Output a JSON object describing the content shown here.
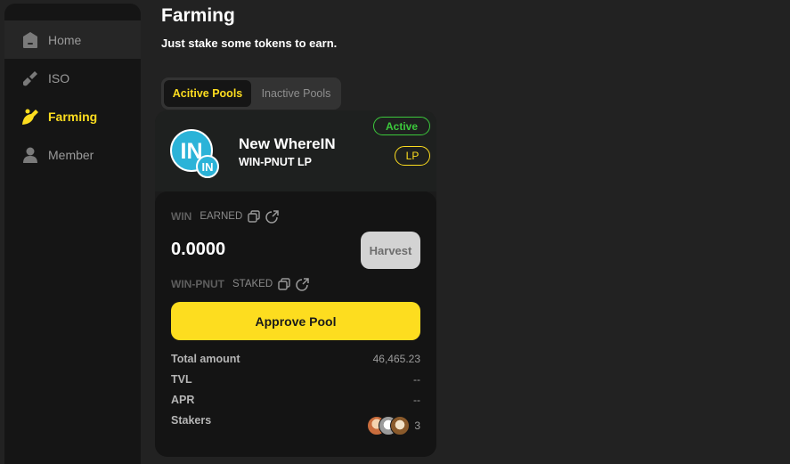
{
  "sidebar": {
    "items": [
      {
        "label": "Home",
        "icon": "home-icon"
      },
      {
        "label": "ISO",
        "icon": "shovel-icon"
      },
      {
        "label": "Farming",
        "icon": "farming-icon"
      },
      {
        "label": "Member",
        "icon": "user-icon"
      }
    ],
    "active_item": "Farming"
  },
  "header": {
    "title": "Farming",
    "subtitle": "Just stake some tokens to earn."
  },
  "tabs": [
    {
      "label": "Acitive Pools",
      "active": true
    },
    {
      "label": "Inactive Pools",
      "active": false
    }
  ],
  "pool": {
    "name": "New WhereIN",
    "pair": "WIN-PNUT LP",
    "status_badge": "Active",
    "type_badge": "LP",
    "logo_text": "IN",
    "earned": {
      "token": "WIN",
      "label": "EARNED",
      "value": "0.0000"
    },
    "harvest_label": "Harvest",
    "staked": {
      "token": "WIN-PNUT",
      "label": "STAKED"
    },
    "approve_label": "Approve Pool",
    "stats": [
      {
        "label": "Total amount",
        "value": "46,465.23"
      },
      {
        "label": "TVL",
        "value": "--"
      },
      {
        "label": "APR",
        "value": "--"
      },
      {
        "label": "Stakers",
        "value": "3"
      }
    ]
  },
  "colors": {
    "accent": "#fddd1f",
    "active_green": "#3cc93c",
    "background": "#222222",
    "panel": "#151515"
  }
}
